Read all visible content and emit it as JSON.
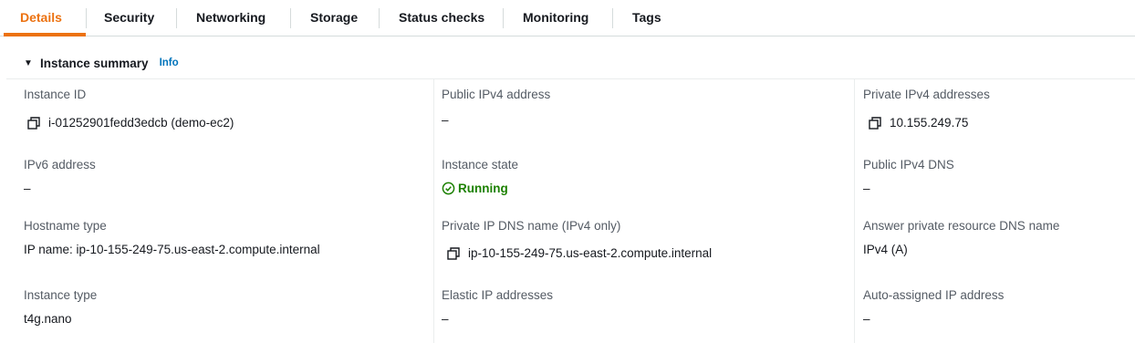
{
  "tabs": [
    {
      "label": "Details",
      "active": true
    },
    {
      "label": "Security"
    },
    {
      "label": "Networking"
    },
    {
      "label": "Storage"
    },
    {
      "label": "Status checks"
    },
    {
      "label": "Monitoring"
    },
    {
      "label": "Tags"
    }
  ],
  "summary": {
    "title": "Instance summary",
    "info_link": "Info"
  },
  "fields": {
    "instance_id": {
      "label": "Instance ID",
      "value": "i-01252901fedd3edcb (demo-ec2)",
      "icon": "copy-icon"
    },
    "public_ipv4": {
      "label": "Public IPv4 address",
      "value": "–"
    },
    "private_ipv4": {
      "label": "Private IPv4 addresses",
      "value": "10.155.249.75",
      "icon": "copy-icon"
    },
    "ipv6": {
      "label": "IPv6 address",
      "value": "–"
    },
    "instance_state": {
      "label": "Instance state",
      "value": "Running",
      "icon": "check-circle-icon",
      "color": "#1d8102"
    },
    "public_ipv4_dns": {
      "label": "Public IPv4 DNS",
      "value": "–"
    },
    "hostname_type": {
      "label": "Hostname type",
      "value": "IP name: ip-10-155-249-75.us-east-2.compute.internal"
    },
    "private_ip_dns": {
      "label": "Private IP DNS name (IPv4 only)",
      "value": "ip-10-155-249-75.us-east-2.compute.internal",
      "icon": "copy-icon"
    },
    "answer_private_dns": {
      "label": "Answer private resource DNS name",
      "value": "IPv4 (A)"
    },
    "instance_type": {
      "label": "Instance type",
      "value": "t4g.nano"
    },
    "elastic_ip": {
      "label": "Elastic IP addresses",
      "value": "–"
    },
    "auto_assigned_ip": {
      "label": "Auto-assigned IP address",
      "value": "–"
    }
  },
  "colors": {
    "accent": "#ec7211",
    "link": "#0073bb",
    "success": "#1d8102"
  }
}
